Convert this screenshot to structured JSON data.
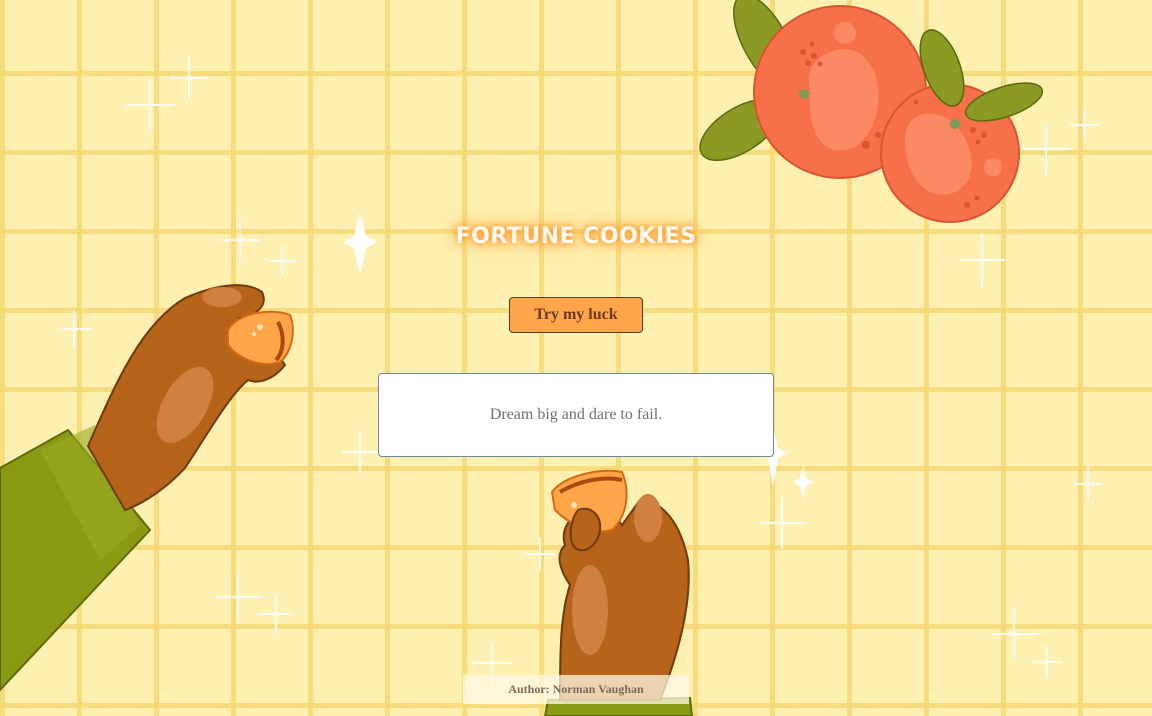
{
  "header": {
    "title": "FORTUNE COOKIES"
  },
  "actions": {
    "luck_label": "Try my luck"
  },
  "fortune": {
    "text": "Dream big and dare to fail."
  },
  "footer": {
    "author": "Author: Norman Vaughan"
  },
  "colors": {
    "background": "#fdf0b0",
    "grid": "#f6d66e",
    "button": "#ffa64a",
    "title_glow": "#ff9a2e",
    "orange": "#f6704a",
    "leaf": "#8a9a22",
    "skin": "#b5641a",
    "sleeve": "#8a9a12"
  },
  "icons": [
    "sparkle-icon",
    "tangerine-icon",
    "leaf-icon",
    "fortune-cookie-icon"
  ]
}
